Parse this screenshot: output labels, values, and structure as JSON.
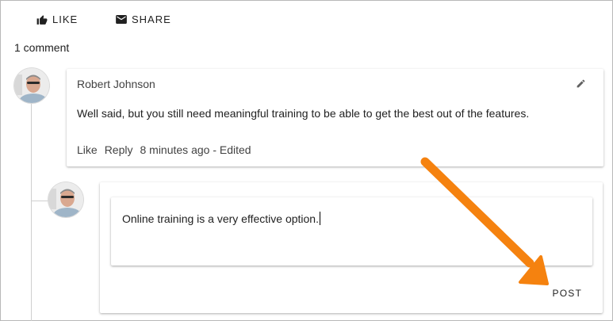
{
  "actions": {
    "like_label": "LIKE",
    "share_label": "SHARE"
  },
  "comments": {
    "count_label": "1 comment"
  },
  "comment": {
    "author": "Robert Johnson",
    "text": "Well said, but you still need meaningful training to be able to get the best out of the features.",
    "like_label": "Like",
    "reply_label": "Reply",
    "time_label": "8 minutes ago - Edited"
  },
  "reply": {
    "input_value": "Online training is a very effective option.",
    "post_label": "POST"
  },
  "icons": {
    "like": "thumb-up-icon",
    "share": "email-icon",
    "edit": "pencil-icon",
    "annotation": "arrow-icon"
  },
  "colors": {
    "annotation_arrow": "#f5820f"
  }
}
